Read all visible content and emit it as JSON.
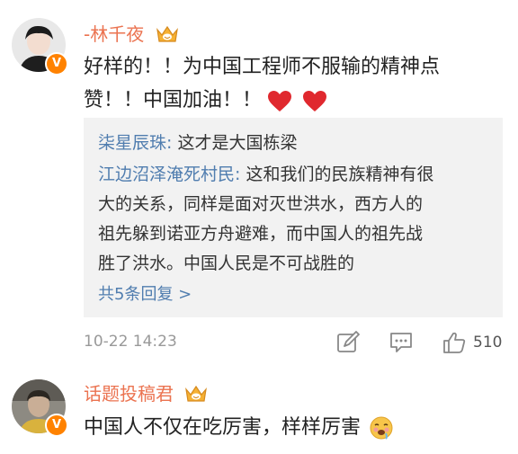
{
  "comments": [
    {
      "username": "-林千夜",
      "lines": [
        "好样的！！为中国工程师不服输的精神点",
        "赞！！中国加油！！"
      ],
      "timestamp": "10-22 14:23",
      "like_count": "510",
      "replies": [
        {
          "user": "柒星辰珠:",
          "lines": [
            " 这才是大国栋梁"
          ]
        },
        {
          "user": "江边沼泽淹死村民:",
          "lines": [
            " 这和我们的民族精神有很",
            "大的关系，同样是面对灭世洪水，西方人的",
            "祖先躲到诺亚方舟避难，而中国人的祖先战",
            "胜了洪水。中国人民是不可战胜的"
          ]
        }
      ],
      "more_replies": "共5条回复 >"
    },
    {
      "username": "话题投稿君",
      "lines": [
        "中国人不仅在吃厉害，样样厉害"
      ]
    }
  ],
  "badge_symbol": "V",
  "icons": {
    "crown": "crown-icon",
    "heart": "heart-icon",
    "edit": "edit-icon",
    "comment": "comment-icon",
    "like": "thumbs-up-icon",
    "emoji": "drooling-face-emoji"
  },
  "colors": {
    "username": "#eb7350",
    "reply_user": "#507daf",
    "badge": "#ff8200",
    "heart": "#e0282e",
    "reply_bg": "#f2f2f2",
    "meta": "#999999"
  }
}
